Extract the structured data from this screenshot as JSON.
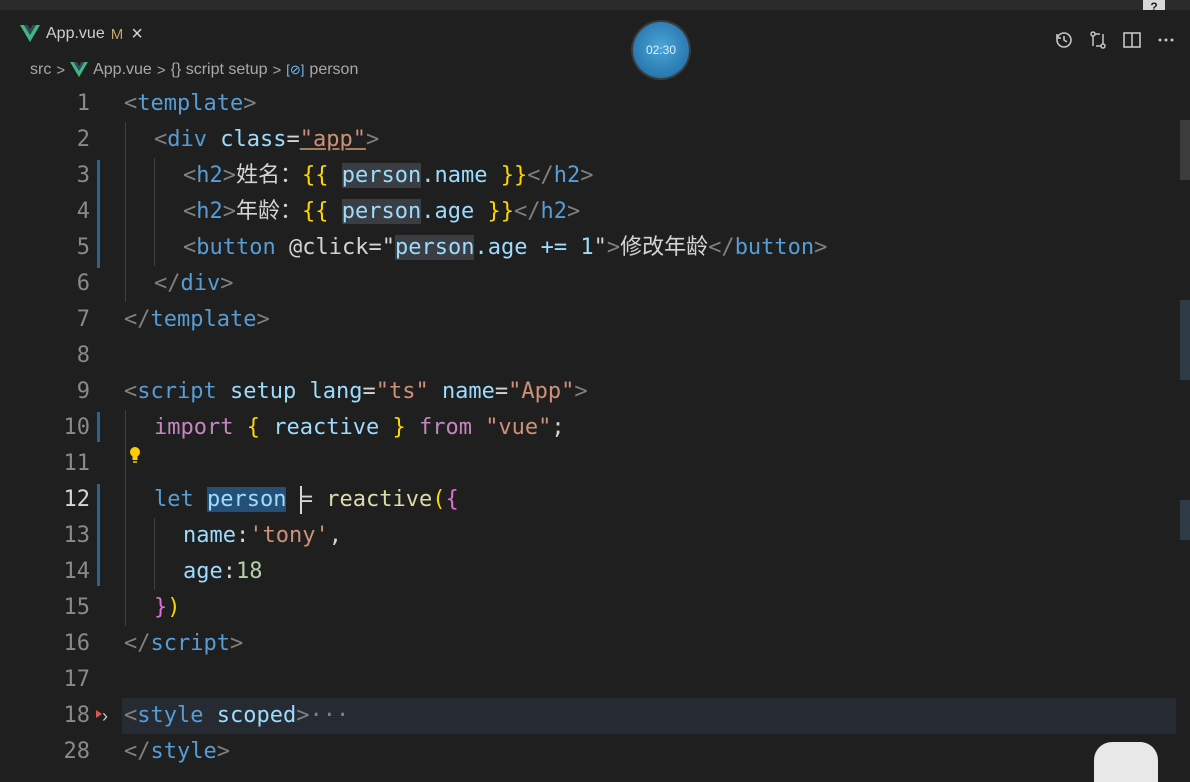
{
  "tab": {
    "label": "App.vue",
    "modified": "M",
    "close": "×"
  },
  "timer": "02:30",
  "help": "?",
  "actions": [
    "history-icon",
    "compare-changes-icon",
    "split-editor-icon",
    "more-actions-icon"
  ],
  "breadcrumb": {
    "items": [
      "src",
      "App.vue",
      "{} script setup",
      "person"
    ],
    "symbol_badge": "[⊘]"
  },
  "lines": [
    {
      "n": "1"
    },
    {
      "n": "2"
    },
    {
      "n": "3"
    },
    {
      "n": "4"
    },
    {
      "n": "5"
    },
    {
      "n": "6"
    },
    {
      "n": "7"
    },
    {
      "n": "8"
    },
    {
      "n": "9"
    },
    {
      "n": "10"
    },
    {
      "n": "11"
    },
    {
      "n": "12"
    },
    {
      "n": "13"
    },
    {
      "n": "14"
    },
    {
      "n": "15"
    },
    {
      "n": "16"
    },
    {
      "n": "17"
    },
    {
      "n": "18"
    },
    {
      "n": "28"
    }
  ],
  "code": {
    "l1": [
      "<",
      "template",
      ">"
    ],
    "l2": [
      "<",
      "div",
      " ",
      "class",
      "=",
      "\"app\"",
      ">"
    ],
    "l3": [
      "<",
      "h2",
      ">",
      "姓名：",
      "{{",
      " ",
      "person",
      ".name",
      " ",
      "}}",
      "</",
      "h2",
      ">"
    ],
    "l4": [
      "<",
      "h2",
      ">",
      "年龄：",
      "{{",
      " ",
      "person",
      ".age",
      " ",
      "}}",
      "</",
      "h2",
      ">"
    ],
    "l5": [
      "<",
      "button",
      " ",
      "@click",
      "=\"",
      "person",
      ".age += 1",
      "\"",
      ">",
      "修改年龄",
      "</",
      "button",
      ">"
    ],
    "l6": [
      "</",
      "div",
      ">"
    ],
    "l7": [
      "</",
      "template",
      ">"
    ],
    "l9": [
      "<",
      "script",
      " ",
      "setup",
      " ",
      "lang",
      "=",
      "\"ts\"",
      " ",
      "name",
      "=",
      "\"App\"",
      ">"
    ],
    "l10": [
      "import",
      " ",
      "{",
      " ",
      "reactive",
      " ",
      "}",
      " ",
      "from",
      " ",
      "\"vue\"",
      ";"
    ],
    "l12": [
      "let",
      " ",
      "person",
      " = ",
      "reactive",
      "(",
      "{"
    ],
    "l13": [
      "name",
      ":",
      "'tony'",
      ","
    ],
    "l14": [
      "age",
      ":",
      "18"
    ],
    "l15": [
      "}",
      ")"
    ],
    "l16": [
      "</",
      "script",
      ">"
    ],
    "l18": [
      "<",
      "style",
      " ",
      "scoped",
      ">",
      "···"
    ],
    "l28": [
      "</",
      "style",
      ">"
    ]
  },
  "colors": {
    "background": "#1f1f1f",
    "keyword": "#569cd6",
    "string": "#ce9178",
    "attribute": "#9cdcfe",
    "function": "#dcdcaa",
    "selection": "#264f78"
  }
}
